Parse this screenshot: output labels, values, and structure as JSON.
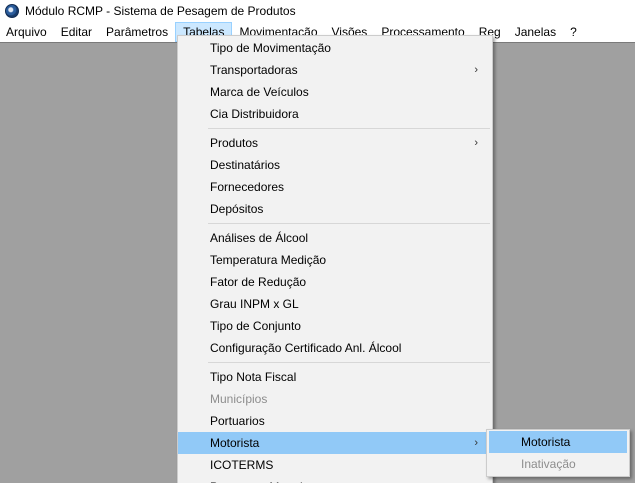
{
  "window": {
    "title": "Módulo RCMP - Sistema de Pesagem de Produtos"
  },
  "menubar": [
    {
      "label": "Arquivo"
    },
    {
      "label": "Editar"
    },
    {
      "label": "Parâmetros"
    },
    {
      "label": "Tabelas",
      "active": true
    },
    {
      "label": "Movimentação"
    },
    {
      "label": "Visões"
    },
    {
      "label": "Processamento"
    },
    {
      "label": "Reg"
    },
    {
      "label": "Janelas"
    },
    {
      "label": "?"
    }
  ],
  "tabelas_menu": {
    "groups": [
      [
        {
          "label": "Tipo de Movimentação"
        },
        {
          "label": "Transportadoras",
          "submenu": true
        },
        {
          "label": "Marca de Veículos"
        },
        {
          "label": "Cia Distribuidora"
        }
      ],
      [
        {
          "label": "Produtos",
          "submenu": true
        },
        {
          "label": "Destinatários"
        },
        {
          "label": "Fornecedores"
        },
        {
          "label": "Depósitos"
        }
      ],
      [
        {
          "label": "Análises de Álcool"
        },
        {
          "label": "Temperatura Medição"
        },
        {
          "label": "Fator de Redução"
        },
        {
          "label": "Grau INPM x GL"
        },
        {
          "label": "Tipo de Conjunto"
        },
        {
          "label": "Configuração Certificado Anl. Álcool"
        }
      ],
      [
        {
          "label": "Tipo Nota Fiscal"
        },
        {
          "label": "Municípios",
          "disabled": true
        },
        {
          "label": "Portuarios"
        },
        {
          "label": "Motorista",
          "submenu": true,
          "highlight": true
        },
        {
          "label": "ICOTERMS"
        },
        {
          "label": "Pessoas e Motoristas",
          "submenu": true
        }
      ]
    ],
    "arrow_glyph": "›"
  },
  "motorista_submenu": [
    {
      "label": "Motorista",
      "highlight": true
    },
    {
      "label": "Inativação",
      "disabled": true
    }
  ],
  "colors": {
    "workspace": "#a0a0a0",
    "menu_bg": "#f2f2f2",
    "highlight": "#91c9f7",
    "active_menubar": "#cce8ff",
    "disabled_text": "#8d8d8d"
  }
}
